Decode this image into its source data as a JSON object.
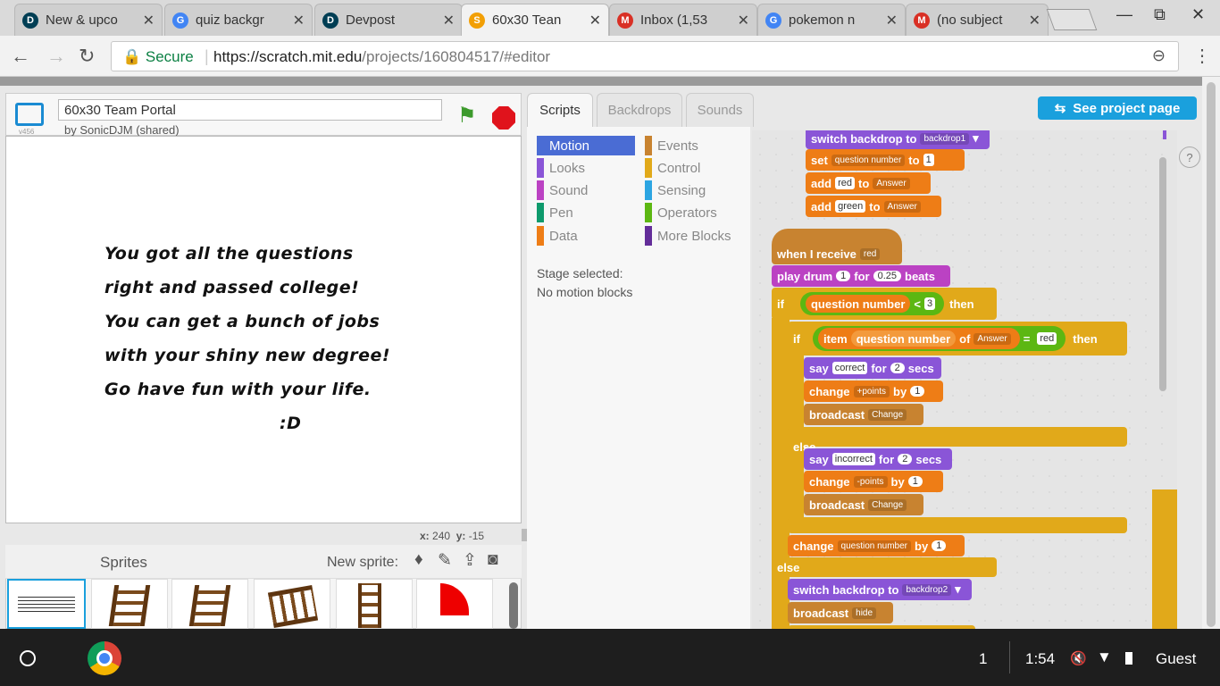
{
  "tabs": [
    {
      "title": "New & upco",
      "icon": "D",
      "color": "#003e54"
    },
    {
      "title": "quiz backgr",
      "icon": "G",
      "color": "#4285f4"
    },
    {
      "title": "Devpost",
      "icon": "D",
      "color": "#003e54"
    },
    {
      "title": "60x30 Tean",
      "icon": "S",
      "color": "#f29f05"
    },
    {
      "title": "Inbox (1,53",
      "icon": "M",
      "color": "#d93025"
    },
    {
      "title": "pokemon n",
      "icon": "G",
      "color": "#4285f4"
    },
    {
      "title": "(no subject",
      "icon": "M",
      "color": "#d93025"
    }
  ],
  "omnibox": {
    "secure": "Secure",
    "url_host": "https://scratch.mit.edu",
    "url_path": "/projects/160804517/#editor"
  },
  "project": {
    "title": "60x30 Team Portal",
    "author": "by SonicDJM (shared)",
    "version": "v456"
  },
  "stage": {
    "lines": [
      "You got all the questions",
      "right and passed college!",
      "You can get a bunch of jobs",
      "with your shiny new degree!",
      "Go have fun with your life.",
      ":D"
    ],
    "x_label": "x:",
    "x": "240",
    "y_label": "y:",
    "y": "-15"
  },
  "sprites": {
    "title": "Sprites",
    "new_sprite": "New sprite:"
  },
  "editor_tabs": [
    "Scripts",
    "Backdrops",
    "Sounds"
  ],
  "categories_left": [
    {
      "label": "Motion",
      "color": "#4a6cd4"
    },
    {
      "label": "Looks",
      "color": "#8a55d7"
    },
    {
      "label": "Sound",
      "color": "#bb42c3"
    },
    {
      "label": "Pen",
      "color": "#0e9a6c"
    },
    {
      "label": "Data",
      "color": "#ee7d16"
    }
  ],
  "categories_right": [
    {
      "label": "Events",
      "color": "#c88330"
    },
    {
      "label": "Control",
      "color": "#e1a91a"
    },
    {
      "label": "Sensing",
      "color": "#2ca5e2"
    },
    {
      "label": "Operators",
      "color": "#5cb712"
    },
    {
      "label": "More Blocks",
      "color": "#632d99"
    }
  ],
  "palette_msg": {
    "line1": "Stage selected:",
    "line2": "No motion blocks"
  },
  "see_project": "See project page",
  "blocks": {
    "switch1": "switch backdrop to",
    "backdrop1": "backdrop1",
    "set": "set",
    "qnum": "question number",
    "to": "to",
    "one": "1",
    "add": "add",
    "red": "red",
    "answer": "Answer",
    "green": "green",
    "when_receive": "when I receive",
    "play_drum": "play drum",
    "drum_n": "1",
    "for": "for",
    "beats_val": "0.25",
    "beats": "beats",
    "if": "if",
    "lt": "<",
    "three": "3",
    "then": "then",
    "item": "item",
    "of": "of",
    "eq": "=",
    "say": "say",
    "correct": "correct",
    "two": "2",
    "secs": "secs",
    "change": "change",
    "plus_points": "+points",
    "by": "by",
    "broadcast": "broadcast",
    "change_msg": "Change",
    "else": "else",
    "incorrect": "incorrect",
    "minus_points": "-points",
    "backdrop2": "backdrop2",
    "hide": "hide"
  },
  "shelf": {
    "time": "1:54",
    "user": "Guest",
    "num": "1"
  }
}
